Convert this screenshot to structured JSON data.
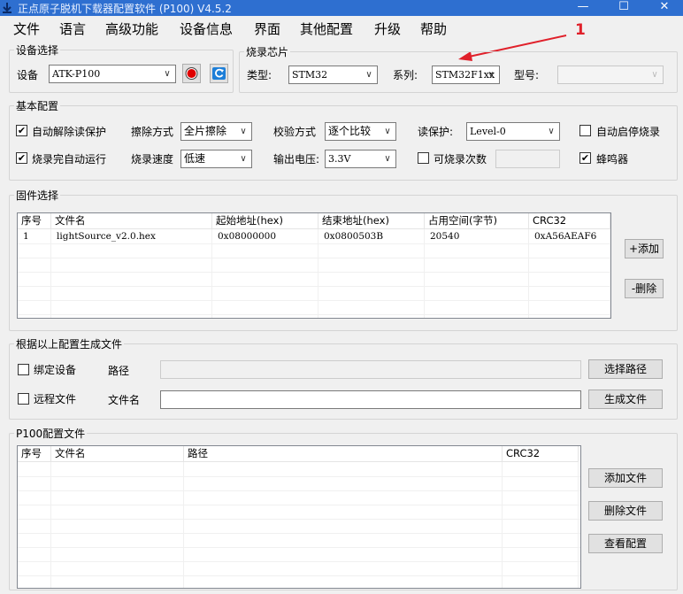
{
  "window": {
    "title": "正点原子脱机下载器配置软件 (P100)  V4.5.2",
    "controls": {
      "minimize": "—",
      "maximize": "☐",
      "close": "✕"
    }
  },
  "menu": [
    "文件",
    "语言",
    "高级功能",
    "设备信息",
    "界面",
    "其他配置",
    "升级",
    "帮助"
  ],
  "annotation": {
    "number": "1",
    "color": "#e0202a"
  },
  "device_select": {
    "title": "设备选择",
    "device_label": "设备",
    "device_value": "ATK-P100",
    "record_color": "#e00000",
    "refresh_color": "#1e7fd8"
  },
  "chip": {
    "title": "烧录芯片",
    "type_label": "类型:",
    "type_value": "STM32",
    "series_label": "系列:",
    "series_value": "STM32F1xx",
    "model_label": "型号:",
    "model_value": ""
  },
  "basic": {
    "title": "基本配置",
    "auto_unprotect": {
      "label": "自动解除读保护",
      "checked": "✔"
    },
    "auto_run": {
      "label": "烧录完自动运行",
      "checked": "✔"
    },
    "erase_label": "擦除方式",
    "erase_value": "全片擦除",
    "speed_label": "烧录速度",
    "speed_value": "低速",
    "verify_label": "校验方式",
    "verify_value": "逐个比较",
    "voltage_label": "输出电压:",
    "voltage_value": "3.3V",
    "read_protect_label": "读保护:",
    "read_protect_value": "Level-0",
    "burn_count_label": "可烧录次数",
    "auto_start_label": "自动启停烧录",
    "buzzer": {
      "label": "蜂鸣器",
      "checked": "✔"
    }
  },
  "firmware": {
    "title": "固件选择",
    "columns": [
      "序号",
      "文件名",
      "起始地址(hex)",
      "结束地址(hex)",
      "占用空间(字节)",
      "CRC32"
    ],
    "rows": [
      [
        "1",
        "lightSource_v2.0.hex",
        "0x08000000",
        "0x0800503B",
        "20540",
        "0xA56AEAF6"
      ]
    ],
    "add_button": "+添加",
    "delete_button": "-删除"
  },
  "generate": {
    "title": "根据以上配置生成文件",
    "bind_device_label": "绑定设备",
    "path_label": "路径",
    "choose_path_button": "选择路径",
    "remote_file_label": "远程文件",
    "filename_label": "文件名",
    "generate_button": "生成文件"
  },
  "p100_config": {
    "title": "P100配置文件",
    "columns": [
      "序号",
      "文件名",
      "路径",
      "CRC32"
    ],
    "add_file_button": "添加文件",
    "delete_file_button": "删除文件",
    "view_config_button": "查看配置"
  }
}
